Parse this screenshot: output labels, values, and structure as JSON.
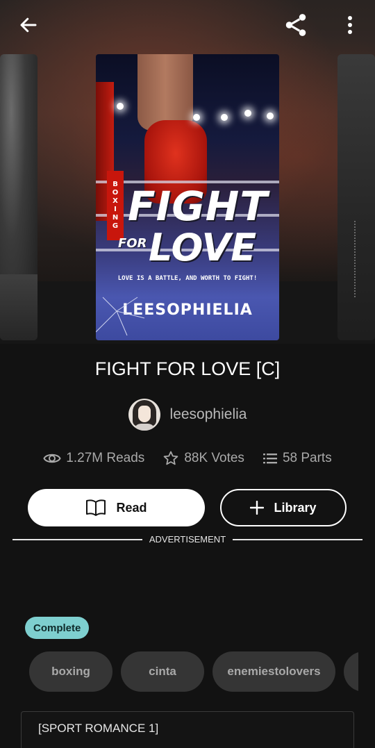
{
  "story": {
    "title": "FIGHT FOR LOVE [C]",
    "author": "leesophielia",
    "cover": {
      "boxing_label": "BOXING",
      "word_fight": "FIGHT",
      "word_for": "FOR",
      "word_love": "LOVE",
      "tagline": "LOVE IS A BATTLE, AND WORTH TO FIGHT!",
      "author_caption": "LEESOPHIELIA"
    }
  },
  "stats": {
    "reads": "1.27M Reads",
    "votes": "88K Votes",
    "parts": "58 Parts"
  },
  "actions": {
    "read_label": "Read",
    "library_label": "Library"
  },
  "ad": {
    "label": "ADVERTISEMENT"
  },
  "status_badge": "Complete",
  "tags": [
    "boxing",
    "cinta",
    "enemiestolovers"
  ],
  "description_first_line": "[SPORT ROMANCE 1]",
  "icons": {
    "back": "arrow-left-icon",
    "share": "share-icon",
    "more": "more-vertical-icon",
    "reads": "eye-icon",
    "votes": "star-icon",
    "parts": "list-icon",
    "read": "book-open-icon",
    "library": "plus-icon"
  },
  "colors": {
    "background": "#121212",
    "badge": "#7ecfcf",
    "tag_bg": "#353535"
  }
}
